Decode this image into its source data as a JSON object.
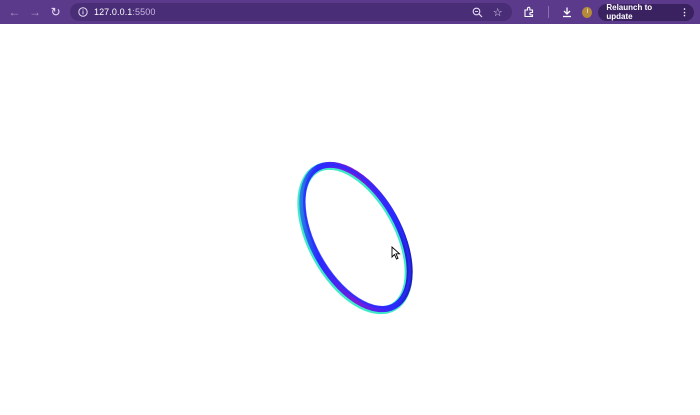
{
  "browser": {
    "url_host": "127.0.0.1",
    "url_port": ":5500",
    "relaunch_label": "Relaunch to update",
    "avatar_letter": "I",
    "toolbar_color": "#5b3a8c",
    "icons": [
      "back-arrow-icon",
      "forward-arrow-icon",
      "reload-icon",
      "site-info-icon",
      "zoom-icon",
      "star-icon",
      "extensions-icon",
      "download-icon",
      "more-menu-icon"
    ]
  },
  "canvas": {
    "shape": "tilted-ring",
    "colors": [
      "#2a2aff",
      "#7a1ad9",
      "#1fe6c0",
      "#101060"
    ]
  }
}
